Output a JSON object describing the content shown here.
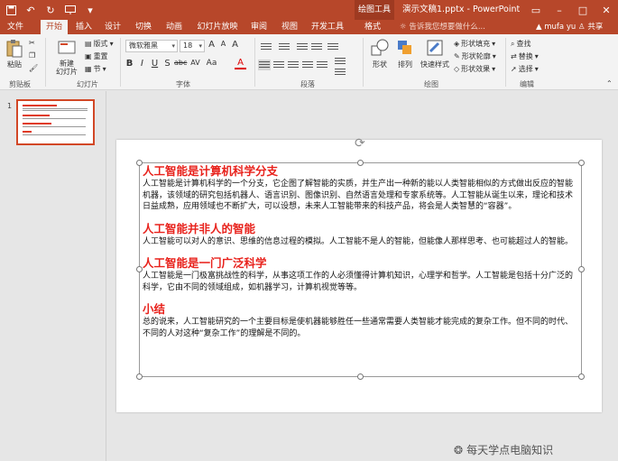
{
  "titlebar": {
    "context_tool": "绘图工具",
    "document_title": "演示文稿1.pptx - PowerPoint"
  },
  "tabs": [
    {
      "label": "文件"
    },
    {
      "label": "开始"
    },
    {
      "label": "插入"
    },
    {
      "label": "设计"
    },
    {
      "label": "切换"
    },
    {
      "label": "动画"
    },
    {
      "label": "幻灯片放映"
    },
    {
      "label": "审阅"
    },
    {
      "label": "视图"
    },
    {
      "label": "开发工具"
    },
    {
      "label": "格式"
    }
  ],
  "tell_me": "告诉我您想要做什么...",
  "user": "mufa yu",
  "share": "共享",
  "ribbon": {
    "clipboard": {
      "paste": "粘贴",
      "group": "剪贴板"
    },
    "slides": {
      "new_slide": "新建\n幻灯片",
      "layout": "版式",
      "reset": "重置",
      "section": "节",
      "group": "幻灯片"
    },
    "font": {
      "font_name": "微软雅黑",
      "font_size": "18",
      "group": "字体"
    },
    "paragraph": {
      "group": "段落"
    },
    "drawing": {
      "shapes": "形状",
      "arrange": "排列",
      "quick_styles": "快速样式",
      "fill": "形状填充",
      "outline": "形状轮廓",
      "effects": "形状效果",
      "group": "绘图"
    },
    "editing": {
      "find": "查找",
      "replace": "替换",
      "select": "选择",
      "group": "编辑"
    }
  },
  "thumbnail": {
    "slide_number": "1"
  },
  "slide": {
    "sections": [
      {
        "heading": "人工智能是计算机科学分支",
        "body": "人工智能是计算机科学的一个分支，它企图了解智能的实质，并生产出一种新的能以人类智能相似的方式做出反应的智能机器，该领域的研究包括机器人、语言识别、图像识别、自然语言处理和专家系统等。人工智能从诞生以来，理论和技术日益成熟，应用领域也不断扩大，可以设想，未来人工智能带来的科技产品，将会是人类智慧的“容器”。"
      },
      {
        "heading": "人工智能并非人的智能",
        "body": "人工智能可以对人的意识、思维的信息过程的模拟。人工智能不是人的智能，但能像人那样思考、也可能超过人的智能。"
      },
      {
        "heading": "人工智能是一门广泛科学",
        "body": "人工智能是一门极富挑战性的科学，从事这项工作的人必须懂得计算机知识，心理学和哲学。人工智能是包括十分广泛的科学，它由不同的领域组成，如机器学习，计算机视觉等等。"
      },
      {
        "heading": "小结",
        "body": "总的说来，人工智能研究的一个主要目标是使机器能够胜任一些通常需要人类智能才能完成的复杂工作。但不同的时代、不同的人对这种“复杂工作”的理解是不同的。"
      }
    ]
  },
  "watermark": "每天学点电脑知识",
  "colors": {
    "accent": "#b7472a",
    "heading": "#e8221c"
  }
}
